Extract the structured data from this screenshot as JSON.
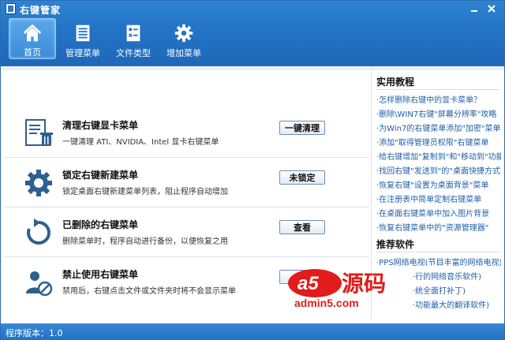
{
  "window": {
    "title": "右键管家"
  },
  "toolbar": {
    "items": [
      {
        "label": "首页",
        "icon": "home-icon"
      },
      {
        "label": "管理菜单",
        "icon": "list-icon"
      },
      {
        "label": "文件类型",
        "icon": "file-type-icon"
      },
      {
        "label": "增加菜单",
        "icon": "gear-icon"
      }
    ]
  },
  "features": [
    {
      "title": "清理右键显卡菜单",
      "desc": "一键清理 ATI、NVIDIA、Intel 显卡右键菜单",
      "button": "一键清理",
      "icon": "clean-document-icon"
    },
    {
      "title": "锁定右键新建菜单",
      "desc": "锁定桌面右键新建菜单列表，阻止程序自动增加",
      "button": "未锁定",
      "icon": "gear-lock-icon"
    },
    {
      "title": "已删除的右键菜单",
      "desc": "删除菜单时，程序自动进行备份，以便恢复之用",
      "button": "查看",
      "icon": "restore-icon"
    },
    {
      "title": "禁止使用右键菜单",
      "desc": "禁用后，右键点击文件或文件夹时将不会显示菜单",
      "button": "",
      "icon": "users-block-icon"
    }
  ],
  "sidebar": {
    "tutorials_title": "实用教程",
    "tutorials": [
      "·怎样删除右键中的显卡菜单？",
      "·删除\\WIN7右键\"屏幕分辨率\"攻略",
      "·为Win7的右键菜单添加\"加密\"菜单",
      "·添加\"取得管理员权限\"右键菜单",
      "·给右键增加\"复制到\"和\"移动到\"功能",
      "·找回右键\"发送到\"的\"桌面快捷方式\"",
      "·恢复右键\"设置为桌面背景\"菜单",
      "·在注册表中简单定制右键菜单",
      "·在桌面右键菜单中加入图片背景",
      "·恢复右键菜单中的\"资源管理器\""
    ],
    "software_title": "推荐软件",
    "software": [
      "·PPS网络电视(节目丰富的网络电视)",
      "·行的网络音乐软件)",
      "·统全面打补丁)",
      "·功能最大的翻译软件)"
    ]
  },
  "status": {
    "version": "程序版本：1.0"
  },
  "watermark": {
    "brand": "源码",
    "site": "admin5.com"
  }
}
